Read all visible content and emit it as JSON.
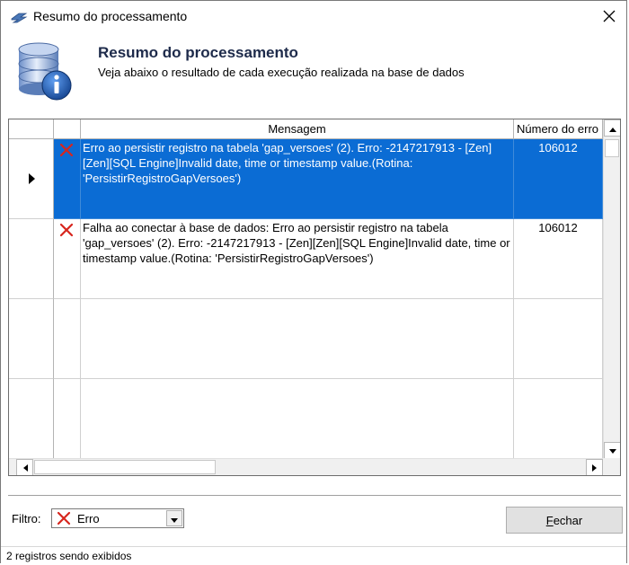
{
  "window": {
    "title": "Resumo do processamento",
    "close_icon": "close-icon"
  },
  "header": {
    "title": "Resumo do processamento",
    "subtitle": "Veja abaixo o resultado de cada execução realizada na base de dados",
    "icon": "database-info-icon"
  },
  "grid": {
    "columns": [
      "",
      "",
      "Mensagem",
      "Número do erro"
    ],
    "rows": [
      {
        "status_icon": "error-x-icon",
        "message": "Erro ao persistir registro na tabela 'gap_versoes' (2). Erro: -2147217913 - [Zen][Zen][SQL Engine]Invalid date, time or timestamp value.(Rotina: 'PersistirRegistroGapVersoes')",
        "error_number": "106012",
        "selected": true
      },
      {
        "status_icon": "error-x-icon",
        "message": "Falha ao conectar à base de dados: Erro ao persistir registro na tabela 'gap_versoes' (2). Erro: -2147217913 - [Zen][Zen][SQL Engine]Invalid date, time or timestamp value.(Rotina: 'PersistirRegistroGapVersoes')",
        "error_number": "106012",
        "selected": false
      }
    ]
  },
  "filter": {
    "label": "Filtro:",
    "selected": "Erro",
    "icon": "error-x-icon"
  },
  "buttons": {
    "close_label_underlined": "F",
    "close_label_rest": "echar"
  },
  "status": {
    "text": "2 registros sendo exibidos"
  },
  "colors": {
    "selection": "#0b6cd4",
    "error_red": "#d7261e",
    "title_text": "#1d2a4a"
  }
}
